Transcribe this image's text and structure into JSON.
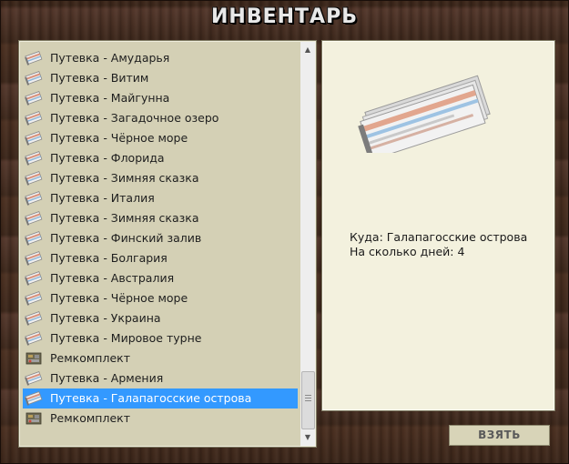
{
  "window": {
    "title": "ИНВЕНТАРЬ"
  },
  "inventory": {
    "items": [
      {
        "label": "Путевка - Амударья",
        "icon": "ticket-icon",
        "selected": false
      },
      {
        "label": "Путевка - Витим",
        "icon": "ticket-icon",
        "selected": false
      },
      {
        "label": "Путевка - Майгунна",
        "icon": "ticket-icon",
        "selected": false
      },
      {
        "label": "Путевка - Загадочное озеро",
        "icon": "ticket-icon",
        "selected": false
      },
      {
        "label": "Путевка - Чёрное море",
        "icon": "ticket-icon",
        "selected": false
      },
      {
        "label": "Путевка - Флорида",
        "icon": "ticket-icon",
        "selected": false
      },
      {
        "label": "Путевка - Зимняя сказка",
        "icon": "ticket-icon",
        "selected": false
      },
      {
        "label": "Путевка - Италия",
        "icon": "ticket-icon",
        "selected": false
      },
      {
        "label": "Путевка - Зимняя сказка",
        "icon": "ticket-icon",
        "selected": false
      },
      {
        "label": "Путевка - Финский залив",
        "icon": "ticket-icon",
        "selected": false
      },
      {
        "label": "Путевка - Болгария",
        "icon": "ticket-icon",
        "selected": false
      },
      {
        "label": "Путевка - Австралия",
        "icon": "ticket-icon",
        "selected": false
      },
      {
        "label": "Путевка - Чёрное море",
        "icon": "ticket-icon",
        "selected": false
      },
      {
        "label": "Путевка - Украина",
        "icon": "ticket-icon",
        "selected": false
      },
      {
        "label": "Путевка - Мировое турне",
        "icon": "ticket-icon",
        "selected": false
      },
      {
        "label": "Ремкомплект",
        "icon": "repair-kit-icon",
        "selected": false
      },
      {
        "label": "Путевка - Армения",
        "icon": "ticket-icon",
        "selected": false
      },
      {
        "label": "Путевка - Галапагосские острова",
        "icon": "ticket-icon",
        "selected": true
      },
      {
        "label": "Ремкомплект",
        "icon": "repair-kit-icon",
        "selected": false
      }
    ],
    "selection_color": "#3399ff"
  },
  "detail": {
    "image_icon": "ticket-bundle-icon",
    "destination_line": "Куда: Галапагосские острова",
    "days_line": "На сколько дней: 4"
  },
  "actions": {
    "take_label": "ВЗЯТЬ"
  }
}
